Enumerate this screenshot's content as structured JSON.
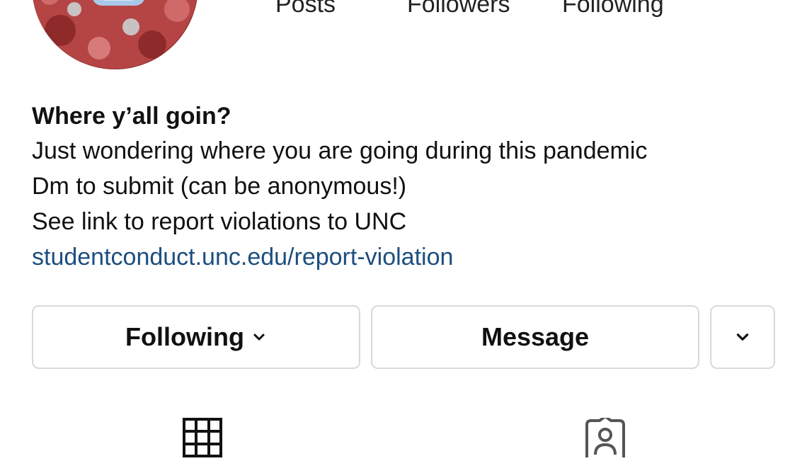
{
  "profile": {
    "stats": {
      "posts_label": "Posts",
      "followers_label": "Followers",
      "following_label": "Following"
    },
    "bio": {
      "name": "Where y’all goin?",
      "lines": [
        "Just wondering where you are going during this pandemic",
        "Dm to submit (can be anonymous!)",
        "See link to report violations to UNC"
      ],
      "link": "studentconduct.unc.edu/report-violation"
    }
  },
  "actions": {
    "following_label": "Following",
    "message_label": "Message"
  },
  "icons": {
    "following_chevron": "chevron-down-icon",
    "more_chevron": "chevron-down-icon",
    "grid_tab": "grid-icon",
    "tagged_tab": "tagged-person-icon"
  },
  "colors": {
    "link": "#1d4e7e",
    "button_border": "#d9d9d9",
    "avatar_red": "#a83636"
  }
}
